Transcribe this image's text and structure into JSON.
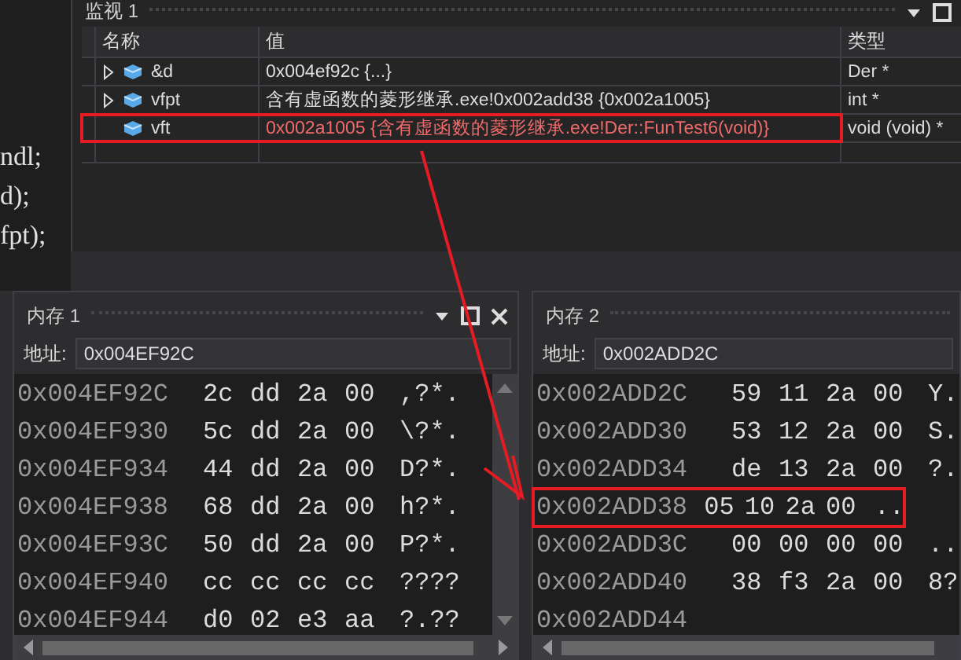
{
  "editor": {
    "lines": [
      "ndl;",
      "d);",
      "fpt);"
    ]
  },
  "watch": {
    "title": "监视 1",
    "columns": [
      "名称",
      "值",
      "类型"
    ],
    "rows": [
      {
        "name": "&d",
        "value": "0x004ef92c {...}",
        "type": "Der *",
        "has_children": true,
        "changed": false,
        "highlighted": false
      },
      {
        "name": "vfpt",
        "value": "含有虚函数的菱形继承.exe!0x002add38 {0x002a1005}",
        "type": "int *",
        "has_children": true,
        "changed": false,
        "highlighted": false
      },
      {
        "name": "vft",
        "value": "0x002a1005 {含有虚函数的菱形继承.exe!Der::FunTest6(void)}",
        "type": "void (void) *",
        "has_children": false,
        "changed": true,
        "highlighted": true
      }
    ]
  },
  "memory_panels": [
    {
      "title": "内存 1",
      "address_label": "地址:",
      "address": "0x004EF92C",
      "show_buttons": true,
      "rows": [
        {
          "address": "0x004EF92C",
          "bytes": [
            "2c",
            "dd",
            "2a",
            "00"
          ],
          "ascii": ",?*.",
          "highlighted": false
        },
        {
          "address": "0x004EF930",
          "bytes": [
            "5c",
            "dd",
            "2a",
            "00"
          ],
          "ascii": "\\?*.",
          "highlighted": false
        },
        {
          "address": "0x004EF934",
          "bytes": [
            "44",
            "dd",
            "2a",
            "00"
          ],
          "ascii": "D?*.",
          "highlighted": false
        },
        {
          "address": "0x004EF938",
          "bytes": [
            "68",
            "dd",
            "2a",
            "00"
          ],
          "ascii": "h?*.",
          "highlighted": false
        },
        {
          "address": "0x004EF93C",
          "bytes": [
            "50",
            "dd",
            "2a",
            "00"
          ],
          "ascii": "P?*.",
          "highlighted": false
        },
        {
          "address": "0x004EF940",
          "bytes": [
            "cc",
            "cc",
            "cc",
            "cc"
          ],
          "ascii": "????",
          "highlighted": false
        },
        {
          "address": "0x004EF944",
          "bytes": [
            "d0",
            "02",
            "e3",
            "aa"
          ],
          "ascii": "?.??",
          "highlighted": false
        }
      ]
    },
    {
      "title": "内存 2",
      "address_label": "地址:",
      "address": "0x002ADD2C",
      "show_buttons": false,
      "rows": [
        {
          "address": "0x002ADD2C",
          "bytes": [
            "59",
            "11",
            "2a",
            "00"
          ],
          "ascii": "Y.",
          "highlighted": false
        },
        {
          "address": "0x002ADD30",
          "bytes": [
            "53",
            "12",
            "2a",
            "00"
          ],
          "ascii": "S.",
          "highlighted": false
        },
        {
          "address": "0x002ADD34",
          "bytes": [
            "de",
            "13",
            "2a",
            "00"
          ],
          "ascii": "?.",
          "highlighted": false
        },
        {
          "address": "0x002ADD38",
          "bytes": [
            "05",
            "10",
            "2a",
            "00"
          ],
          "ascii": "..",
          "highlighted": true
        },
        {
          "address": "0x002ADD3C",
          "bytes": [
            "00",
            "00",
            "00",
            "00"
          ],
          "ascii": "..",
          "highlighted": false
        },
        {
          "address": "0x002ADD40",
          "bytes": [
            "38",
            "f3",
            "2a",
            "00"
          ],
          "ascii": "8?",
          "highlighted": false
        },
        {
          "address": "0x002ADD44",
          "bytes": [],
          "ascii": "",
          "highlighted": false
        }
      ]
    }
  ]
}
